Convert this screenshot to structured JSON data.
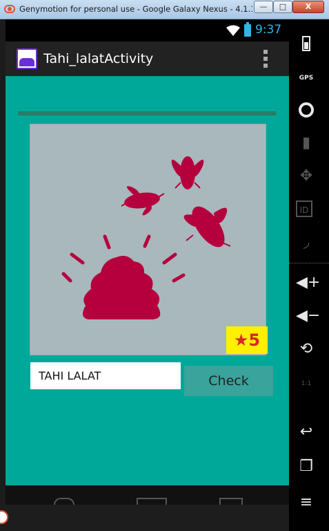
{
  "window": {
    "title": "Genymotion for personal use - Google Galaxy Nexus - 4.1.1 - ...",
    "min_label": "—",
    "max_label": "□",
    "close_label": "X"
  },
  "statusbar": {
    "time": "9:37"
  },
  "actionbar": {
    "title": "Tahi_lalatActivity"
  },
  "puzzle": {
    "badge_star": "★",
    "badge_value": "5",
    "answer_value": "TAHI LALAT",
    "check_label": "Check"
  },
  "sidebar": {
    "gps_label": "GPS",
    "id_label": "ID",
    "scale_label": "1:1"
  },
  "colors": {
    "content_bg": "#00a89a",
    "accent_blue": "#33b5e5",
    "image_fill": "#b5003d",
    "badge_bg": "#ffef00"
  }
}
